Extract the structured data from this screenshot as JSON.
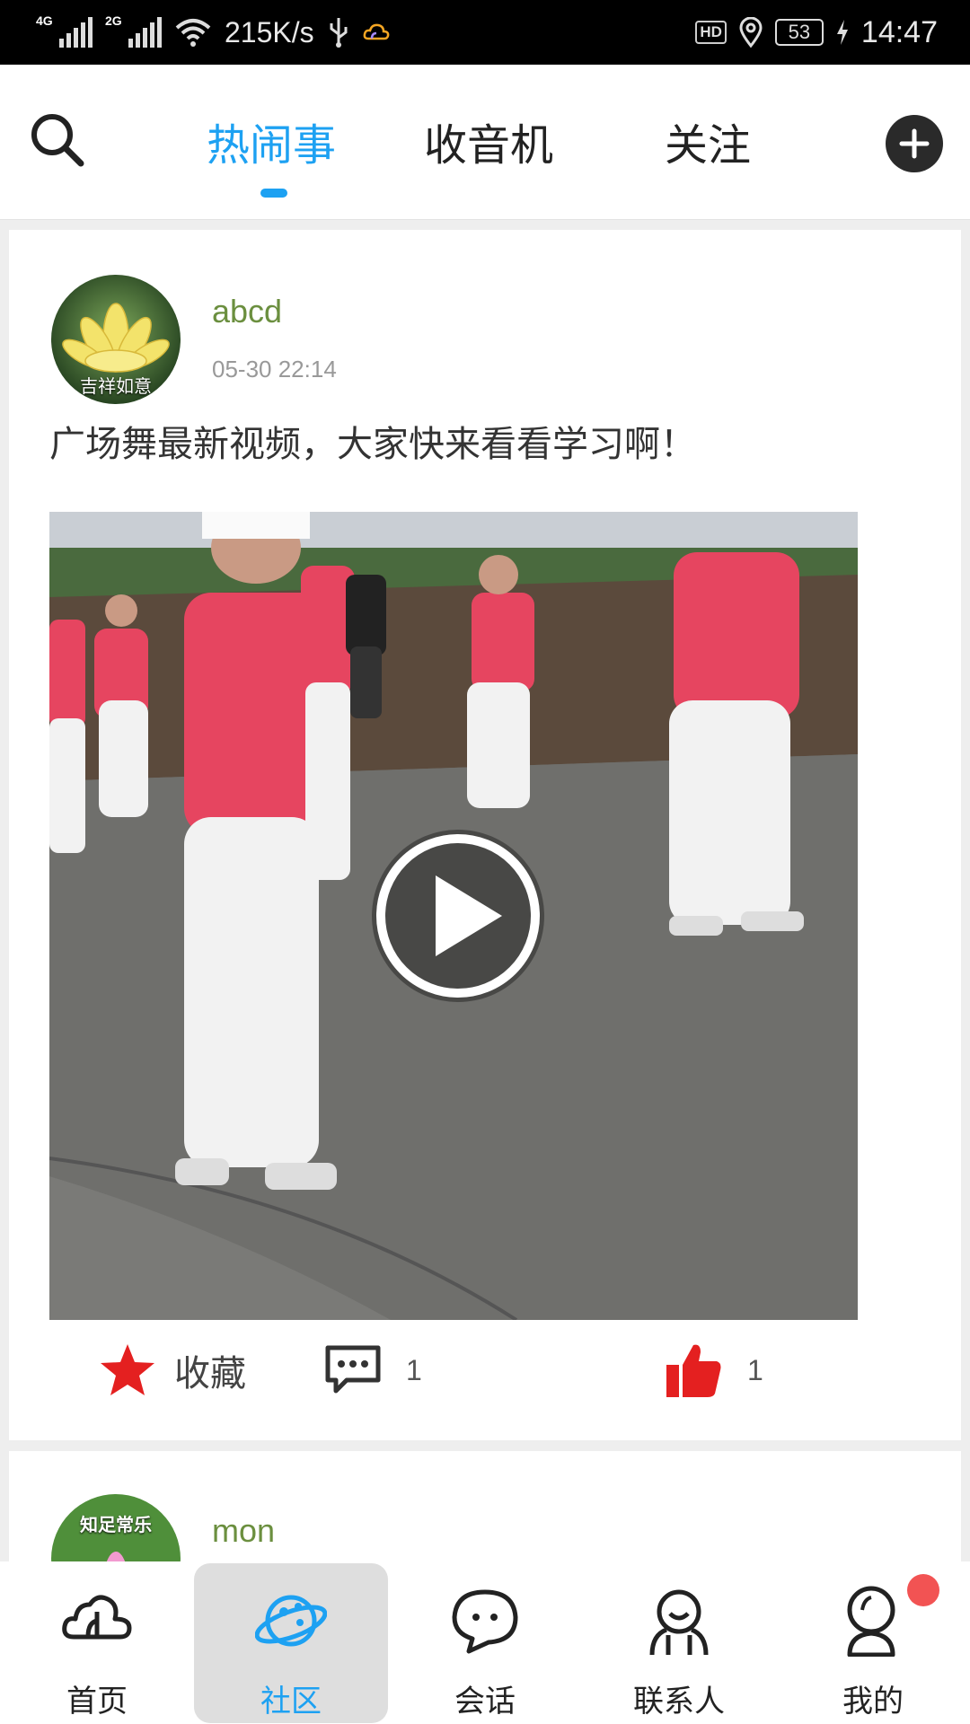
{
  "status_bar": {
    "net1": "4G",
    "net2": "2G",
    "speed": "215K/s",
    "hd": "HD",
    "battery": "53",
    "time": "14:47"
  },
  "top_nav": {
    "tabs": [
      {
        "label": "热闹事",
        "active": true
      },
      {
        "label": "收音机",
        "active": false
      },
      {
        "label": "关注",
        "active": false
      }
    ],
    "accent": "#1da1f2"
  },
  "posts": [
    {
      "username": "abcd",
      "time": "05-30 22:14",
      "avatar_text": "吉祥如意",
      "text": "广场舞最新视频，大家快来看看学习啊！",
      "favorite_label": "收藏",
      "comment_count": "1",
      "like_count": "1"
    },
    {
      "username": "mon",
      "avatar_text": "知足常乐"
    }
  ],
  "bottom_nav": {
    "items": [
      {
        "label": "首页",
        "icon": "cloud-icon"
      },
      {
        "label": "社区",
        "icon": "planet-icon",
        "active": true
      },
      {
        "label": "会话",
        "icon": "chat-bubble-icon"
      },
      {
        "label": "联系人",
        "icon": "contacts-icon"
      },
      {
        "label": "我的",
        "icon": "user-icon"
      }
    ]
  }
}
